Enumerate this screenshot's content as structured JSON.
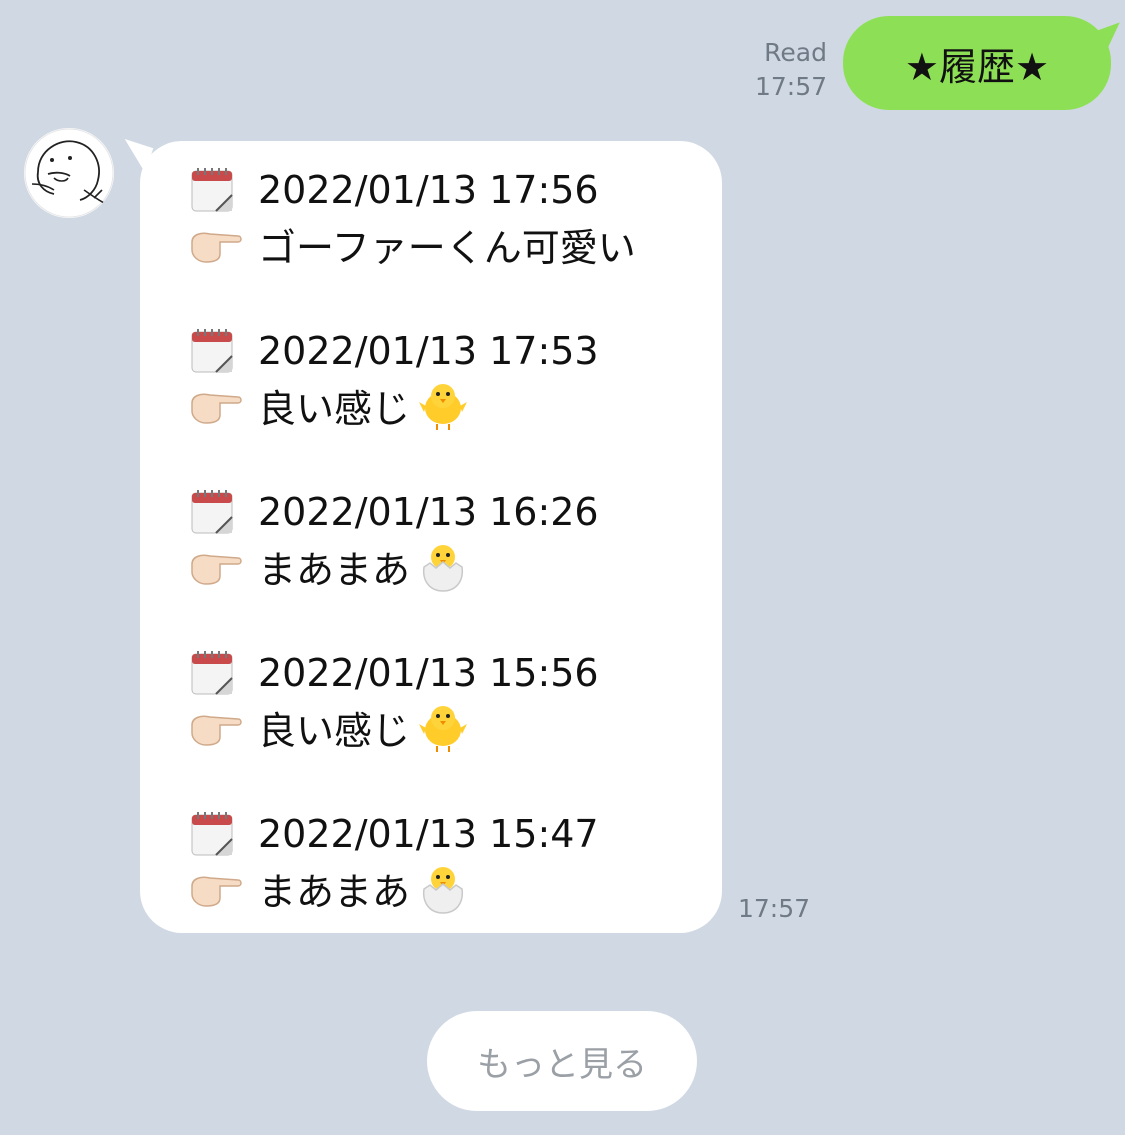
{
  "outgoing": {
    "read_label": "Read",
    "time": "17:57",
    "text": "★履歴★"
  },
  "incoming": {
    "time": "17:57",
    "entries": [
      {
        "datetime": "2022/01/13 17:56",
        "message": "ゴーファーくん可愛い",
        "emoji": ""
      },
      {
        "datetime": "2022/01/13 17:53",
        "message": "良い感じ",
        "emoji": "hatched-chick"
      },
      {
        "datetime": "2022/01/13 16:26",
        "message": "まあまあ",
        "emoji": "hatching-chick"
      },
      {
        "datetime": "2022/01/13 15:56",
        "message": "良い感じ",
        "emoji": "hatched-chick"
      },
      {
        "datetime": "2022/01/13 15:47",
        "message": "まあまあ",
        "emoji": "hatching-chick"
      }
    ]
  },
  "more_button": {
    "label": "もっと見る"
  },
  "colors": {
    "background": "#d0d9e3",
    "outgoing_bubble": "#8de055",
    "incoming_bubble": "#ffffff",
    "meta_text": "#6f7a86"
  },
  "icons": {
    "date_icon": "calendar-icon",
    "pointer_icon": "pointing-hand-icon",
    "avatar": "gopher-avatar"
  }
}
